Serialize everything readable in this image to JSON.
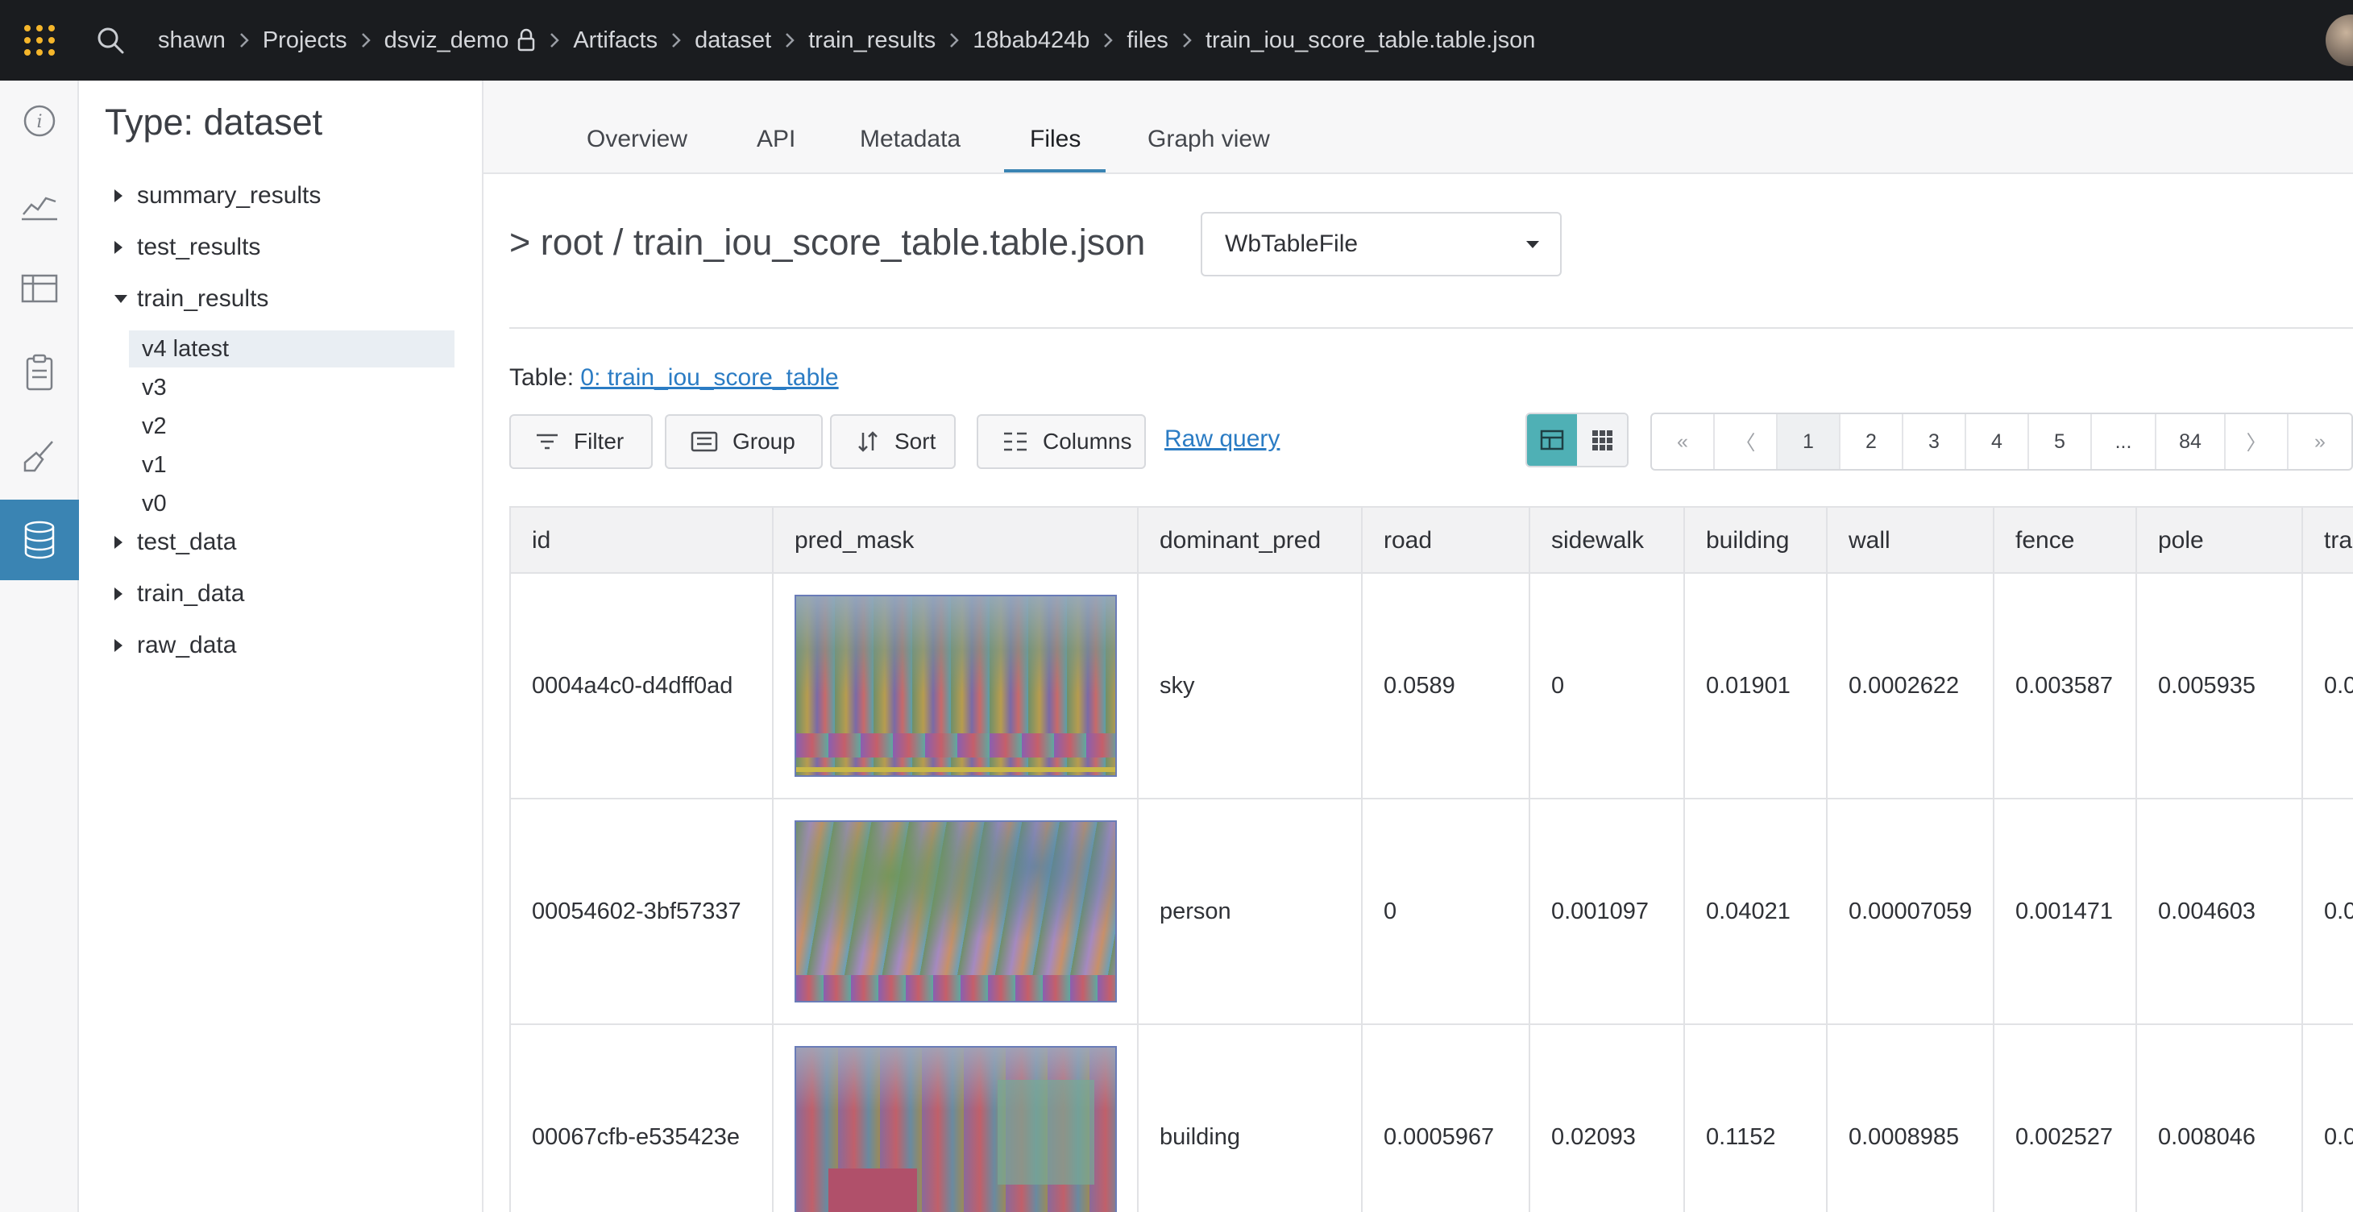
{
  "topbar": {
    "breadcrumb": [
      "shawn",
      "Projects",
      "dsviz_demo",
      "Artifacts",
      "dataset",
      "train_results",
      "18bab424b",
      "files",
      "train_iou_score_table.table.json"
    ]
  },
  "sidebar": {
    "title": "Type: dataset",
    "nodes": {
      "summary": "summary_results",
      "test_results": "test_results",
      "train_results": "train_results",
      "test_data": "test_data",
      "train_data": "train_data",
      "raw_data": "raw_data"
    },
    "versions": [
      "v4 latest",
      "v3",
      "v2",
      "v1",
      "v0"
    ]
  },
  "tabs": [
    "Overview",
    "API",
    "Metadata",
    "Files",
    "Graph view"
  ],
  "file": {
    "path": "> root / train_iou_score_table.table.json",
    "viewer": "WbTableFile",
    "table_prefix": "Table: ",
    "table_link": "0: train_iou_score_table"
  },
  "toolbar": {
    "filter": "Filter",
    "group": "Group",
    "sort": "Sort",
    "columns": "Columns",
    "raw_query": "Raw query"
  },
  "pager": [
    "«",
    "〈",
    "1",
    "2",
    "3",
    "4",
    "5",
    "...",
    "84",
    "〉",
    "»"
  ],
  "table": {
    "headers": [
      "id",
      "pred_mask",
      "dominant_pred",
      "road",
      "sidewalk",
      "building",
      "wall",
      "fence",
      "pole",
      "tra"
    ],
    "rows": [
      {
        "id": "0004a4c0-d4dff0ad",
        "dominant_pred": "sky",
        "road": "0.0589",
        "sidewalk": "0",
        "building": "0.01901",
        "wall": "0.0002622",
        "fence": "0.003587",
        "pole": "0.005935",
        "tra": "0.0"
      },
      {
        "id": "00054602-3bf57337",
        "dominant_pred": "person",
        "road": "0",
        "sidewalk": "0.001097",
        "building": "0.04021",
        "wall": "0.00007059",
        "fence": "0.001471",
        "pole": "0.004603",
        "tra": "0.0"
      },
      {
        "id": "00067cfb-e535423e",
        "dominant_pred": "building",
        "road": "0.0005967",
        "sidewalk": "0.02093",
        "building": "0.1152",
        "wall": "0.0008985",
        "fence": "0.002527",
        "pole": "0.008046",
        "tra": "0.0"
      }
    ]
  }
}
